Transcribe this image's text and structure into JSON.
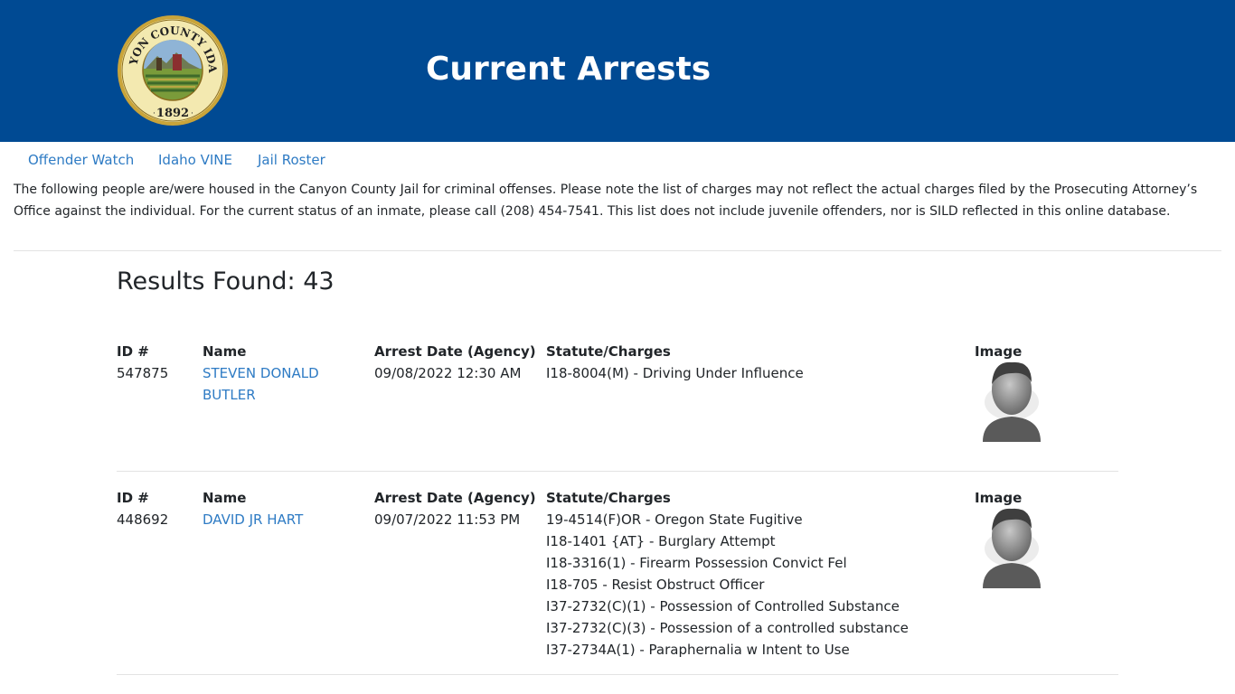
{
  "header": {
    "title": "Current Arrests",
    "seal": {
      "top_text": "CANYON COUNTY IDAHO",
      "year": "1892"
    }
  },
  "nav": {
    "items": [
      {
        "label": "Offender Watch"
      },
      {
        "label": "Idaho VINE"
      },
      {
        "label": "Jail Roster"
      }
    ]
  },
  "intro": "The following people are/were housed in the Canyon County Jail for criminal offenses. Please note the list of charges may not reflect the actual charges filed by the Prosecuting Attorney’s Office against the individual. For the current status of an inmate, please call (208) 454-7541. This list does not include juvenile offenders, nor is SILD reflected in this online database.",
  "results": {
    "heading": "Results Found: 43",
    "columns": {
      "id": "ID #",
      "name": "Name",
      "arrest_date": "Arrest Date (Agency)",
      "charges": "Statute/Charges",
      "image": "Image"
    },
    "records": [
      {
        "id": "547875",
        "name": "STEVEN DONALD BUTLER",
        "arrest_date": "09/08/2022 12:30 AM",
        "charges": [
          "I18-8004(M) - Driving Under Influence"
        ],
        "image_icon": "default-avatar-icon"
      },
      {
        "id": "448692",
        "name": "DAVID JR HART",
        "arrest_date": "09/07/2022 11:53 PM",
        "charges": [
          "19-4514(F)OR - Oregon State Fugitive",
          "I18-1401 {AT} - Burglary Attempt",
          "I18-3316(1) - Firearm Possession Convict Fel",
          "I18-705 - Resist Obstruct Officer",
          "I37-2732(C)(1) - Possession of Controlled Substance",
          "I37-2732(C)(3) - Possession of a controlled substance",
          "I37-2734A(1) - Paraphernalia w Intent to Use"
        ],
        "image_icon": "default-avatar-icon"
      }
    ]
  },
  "colors": {
    "header_bg": "#004a93",
    "link": "#2e7bc4",
    "text": "#212529",
    "divider": "#e3e3e3"
  }
}
